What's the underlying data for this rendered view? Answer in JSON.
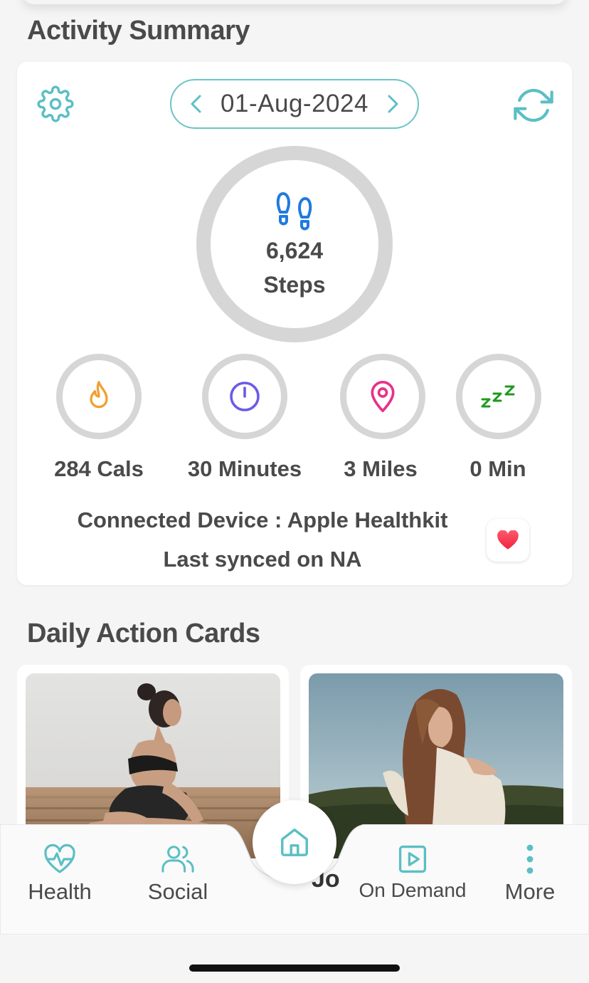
{
  "activity": {
    "section_title": "Activity Summary",
    "date": "01-Aug-2024",
    "steps_value": "6,624",
    "steps_label": "Steps",
    "stats": [
      {
        "label": "284 Cals",
        "icon": "flame-icon",
        "color": "#f0a030"
      },
      {
        "label": "30 Minutes",
        "icon": "timer-icon",
        "color": "#6a5be8"
      },
      {
        "label": "3 Miles",
        "icon": "location-pin-icon",
        "color": "#e8308a"
      },
      {
        "label": "0 Min",
        "icon": "sleep-zzz-icon",
        "color": "#1e9a1e"
      }
    ],
    "connected_device": "Connected Device : Apple Healthkit",
    "last_synced": "Last synced on NA"
  },
  "daily": {
    "section_title": "Daily Action Cards"
  },
  "tabs": {
    "health": "Health",
    "social": "Social",
    "on_demand": "On Demand",
    "more": "More",
    "partial_text": "Jo"
  },
  "colors": {
    "accent": "#5bbfc4",
    "steps_icon": "#1f7ae0",
    "ring": "#d6d6d6"
  }
}
